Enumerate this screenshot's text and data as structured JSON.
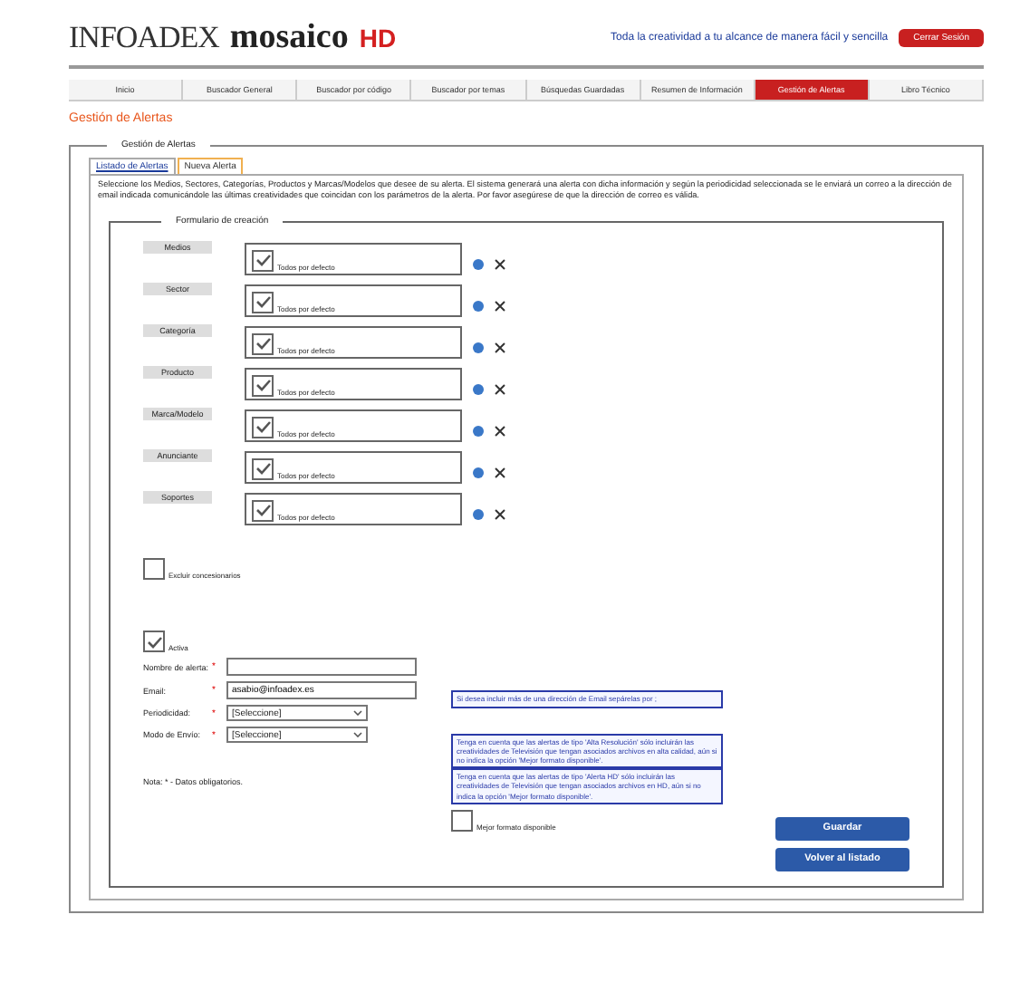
{
  "header": {
    "logo_left": "INFOADEX",
    "logo_right": "mosaico",
    "logo_hd": "HD",
    "tagline": "Toda la creatividad a tu alcance de manera fácil y sencilla",
    "logout": "Cerrar Sesión"
  },
  "nav": [
    {
      "label": "Inicio",
      "selected": false
    },
    {
      "label": "Buscador General",
      "selected": false
    },
    {
      "label": "Buscador por código",
      "selected": false
    },
    {
      "label": "Buscador por temas",
      "selected": false
    },
    {
      "label": "Búsquedas Guardadas",
      "selected": false
    },
    {
      "label": "Resumen de Información",
      "selected": false
    },
    {
      "label": "Gestión de Alertas",
      "selected": true
    },
    {
      "label": "Libro Técnico",
      "selected": false
    }
  ],
  "page_title": "Gestión de Alertas",
  "panel": {
    "legend": "Gestión de Alertas",
    "tabs": [
      {
        "label": "Listado de Alertas",
        "selected": false
      },
      {
        "label": "Nueva Alerta",
        "selected": true
      }
    ],
    "description": "Seleccione los Medios, Sectores, Categorías, Productos y Marcas/Modelos que desee de su alerta. El sistema generará una alerta con dicha información y según la periodicidad seleccionada se le enviará un correo a la dirección de email indicada comunicándole las últimas creatividades que coincidan con los parámetros de la alerta. Por favor asegúrese de que la dirección de correo es válida.",
    "form": {
      "legend": "Formulario de creación",
      "criteria": [
        {
          "label": "Medios",
          "checked": true,
          "default_text": "Todos por defecto"
        },
        {
          "label": "Sector",
          "checked": true,
          "default_text": "Todos por defecto"
        },
        {
          "label": "Categoría",
          "checked": true,
          "default_text": "Todos por defecto"
        },
        {
          "label": "Producto",
          "checked": true,
          "default_text": "Todos por defecto"
        },
        {
          "label": "Marca/Modelo",
          "checked": true,
          "default_text": "Todos por defecto"
        },
        {
          "label": "Anunciante",
          "checked": true,
          "default_text": "Todos por defecto"
        },
        {
          "label": "Soportes",
          "checked": true,
          "default_text": "Todos por defecto"
        }
      ],
      "exclude": {
        "label": "Excluir concesionarios",
        "checked": false
      },
      "active": {
        "label": "Activa",
        "checked": true
      },
      "fields": [
        {
          "kind": "text",
          "label": "Nombre de alerta:",
          "required_mark": "*"
        },
        {
          "kind": "text",
          "label": "Email:",
          "required_mark": "*",
          "value": "asabio@infoadex.es"
        },
        {
          "kind": "select",
          "label": "Periodicidad:",
          "required_mark": "*",
          "value": "[Seleccione]"
        },
        {
          "kind": "select",
          "label": "Modo de Envío:",
          "required_mark": "*",
          "value": "[Seleccione]"
        }
      ],
      "email_note": "Si desea incluir más de una dirección de Email sepárelas por ;",
      "notes": [
        "Tenga en cuenta que las alertas de tipo 'Alta Resolución' sólo incluirán las creatividades de Televisión que tengan asociados archivos en alta calidad, aún si no indica la opción 'Mejor formato disponible'.",
        "Tenga en cuenta que las alertas de tipo 'Alerta HD' sólo incluirán las creatividades de Televisión que tengan asociados archivos en HD, aún si no indica la opción 'Mejor formato disponible'."
      ],
      "best_format": {
        "label": "Mejor formato disponible",
        "checked": false
      },
      "footnote": "Nota: * - Datos obligatorios.",
      "buttons": [
        "Guardar",
        "Volver al listado"
      ]
    }
  }
}
